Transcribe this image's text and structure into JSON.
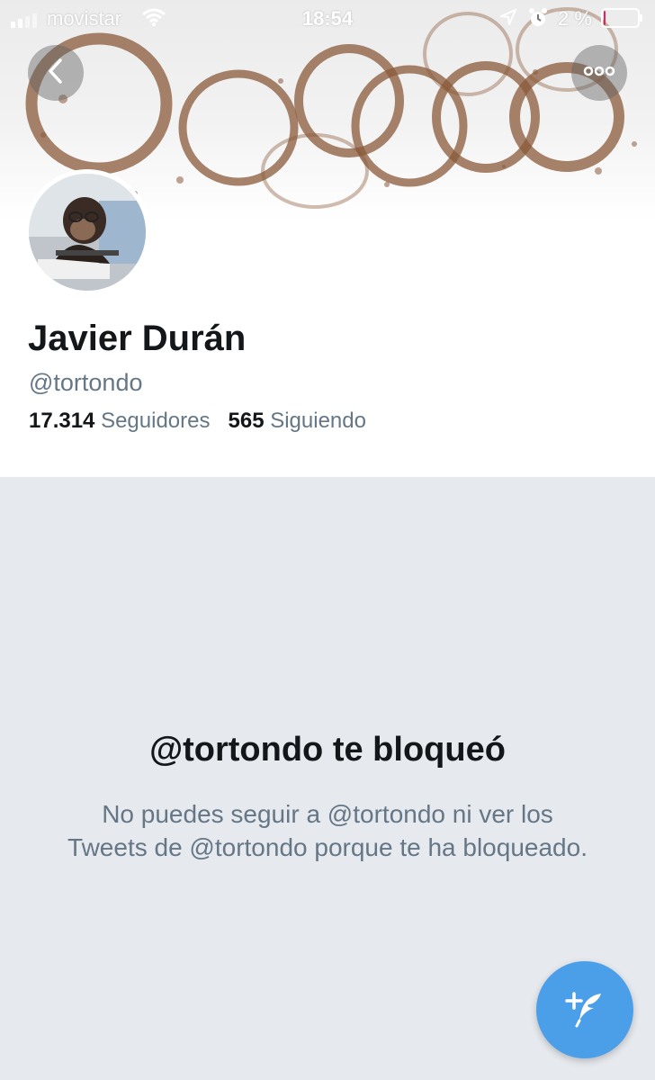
{
  "status_bar": {
    "carrier": "movistar",
    "time": "18:54",
    "battery": "2 %",
    "battery_level": 0.02,
    "icons": [
      "signal-icon",
      "wifi-icon",
      "location-icon",
      "alarm-icon",
      "battery-icon"
    ]
  },
  "header": {
    "back_icon": "chevron-left-icon",
    "more_icon": "ellipsis-icon",
    "banner": "coffee-stain-rings-banner"
  },
  "profile": {
    "name": "Javier Durán",
    "handle": "@tortondo",
    "followers_count": "17.314",
    "followers_label": "Seguidores",
    "following_count": "565",
    "following_label": "Siguiendo",
    "avatar": "chimpanzee-at-computer-photo"
  },
  "blocked": {
    "title": "@tortondo te bloqueó",
    "message": "No puedes seguir a @tortondo ni ver los Tweets de @tortondo porque te ha bloqueado."
  },
  "compose": {
    "icon": "compose-tweet-icon"
  },
  "colors": {
    "accent": "#4a9fe8",
    "secondary_text": "#657786",
    "primary_text": "#14171a",
    "background": "#e6e9ee",
    "battery_low": "#e0245e"
  }
}
